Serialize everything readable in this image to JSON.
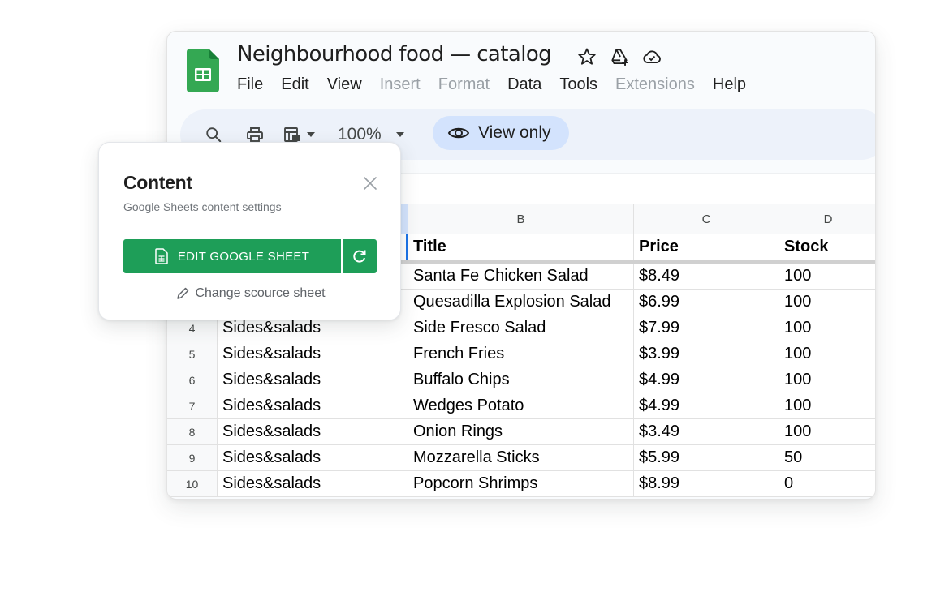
{
  "window": {
    "title": "Neighbourhood food — catalog",
    "menu": [
      {
        "label": "File",
        "disabled": false
      },
      {
        "label": "Edit",
        "disabled": false
      },
      {
        "label": "View",
        "disabled": false
      },
      {
        "label": "Insert",
        "disabled": true
      },
      {
        "label": "Format",
        "disabled": true
      },
      {
        "label": "Data",
        "disabled": false
      },
      {
        "label": "Tools",
        "disabled": false
      },
      {
        "label": "Extensions",
        "disabled": true
      },
      {
        "label": "Help",
        "disabled": false
      }
    ]
  },
  "toolbar": {
    "zoom": "100%",
    "view_only_label": "View only"
  },
  "grid": {
    "columns": [
      "B",
      "C",
      "D"
    ],
    "header_row": {
      "title": "Title",
      "price": "Price",
      "stock": "Stock"
    },
    "rows": [
      {
        "num": "",
        "category": "",
        "title": "Santa Fe Chicken Salad",
        "price": "$8.49",
        "stock": "100"
      },
      {
        "num": "",
        "category": "",
        "title": "Quesadilla Explosion Salad",
        "price": "$6.99",
        "stock": "100"
      },
      {
        "num": "4",
        "category": "Sides&salads",
        "title": "Side Fresco Salad",
        "price": "$7.99",
        "stock": "100"
      },
      {
        "num": "5",
        "category": "Sides&salads",
        "title": "French Fries",
        "price": "$3.99",
        "stock": "100"
      },
      {
        "num": "6",
        "category": "Sides&salads",
        "title": "Buffalo Chips",
        "price": "$4.99",
        "stock": "100"
      },
      {
        "num": "7",
        "category": "Sides&salads",
        "title": "Wedges Potato",
        "price": "$4.99",
        "stock": "100"
      },
      {
        "num": "8",
        "category": "Sides&salads",
        "title": "Onion Rings",
        "price": "$3.49",
        "stock": "100"
      },
      {
        "num": "9",
        "category": "Sides&salads",
        "title": "Mozzarella Sticks",
        "price": "$5.99",
        "stock": "50"
      },
      {
        "num": "10",
        "category": "Sides&salads",
        "title": "Popcorn Shrimps",
        "price": "$8.99",
        "stock": "0"
      }
    ]
  },
  "popup": {
    "title": "Content",
    "subtitle": "Google Sheets content settings",
    "edit_button": "EDIT GOOGLE SHEET",
    "change_link": "Change scource sheet"
  },
  "colors": {
    "sheets_green": "#1e9e58",
    "toolbar_bg": "#edf2fa",
    "view_only_bg": "#d3e3fd",
    "selection_blue": "#1a73e8"
  }
}
